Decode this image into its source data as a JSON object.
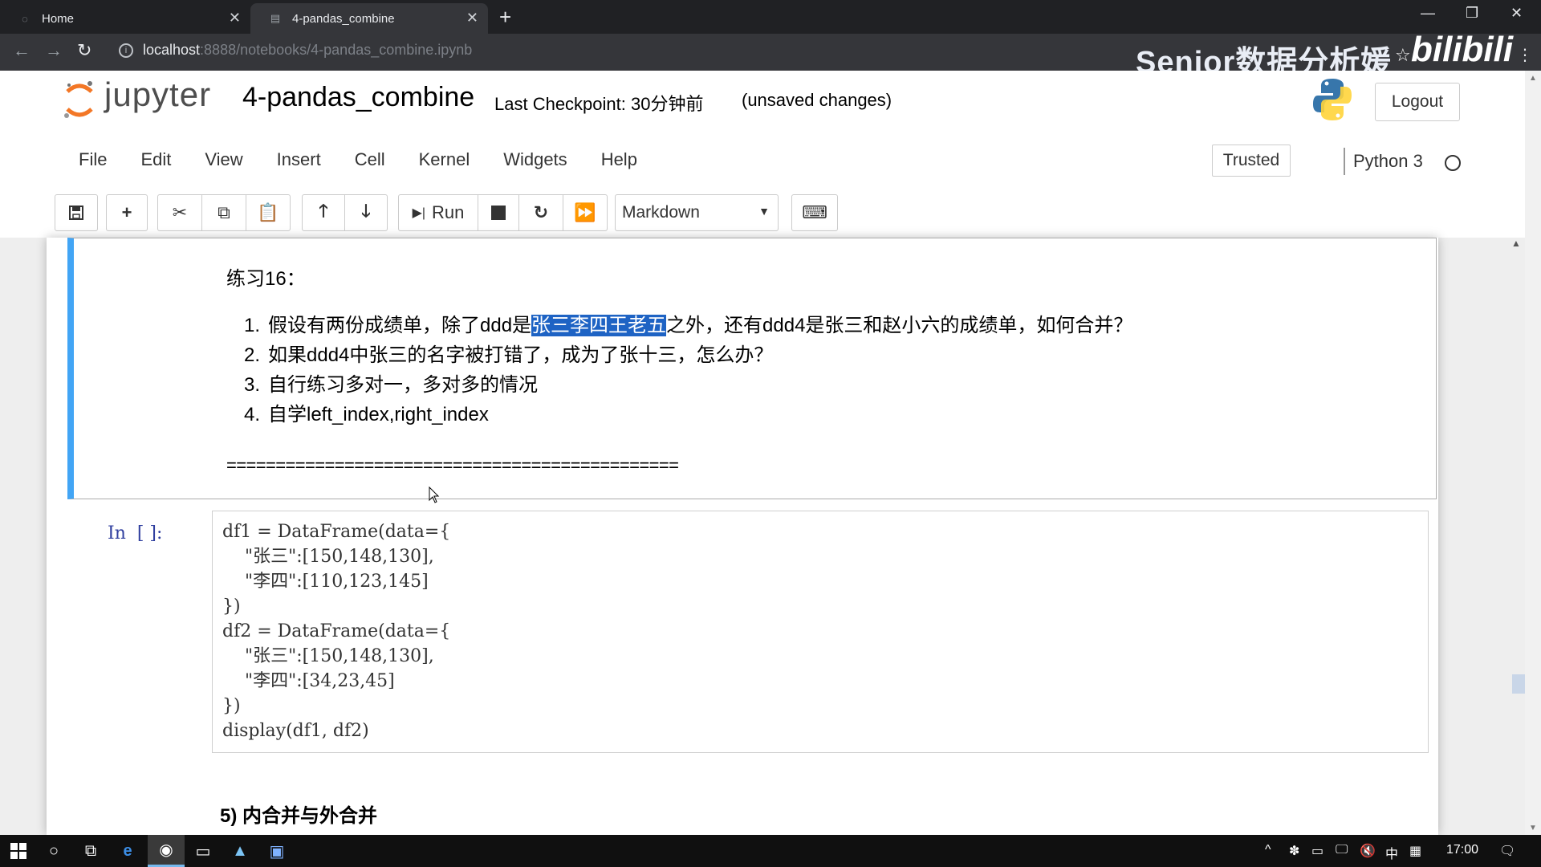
{
  "browser": {
    "tabs": [
      {
        "title": "Home",
        "active": false
      },
      {
        "title": "4-pandas_combine",
        "active": true
      }
    ],
    "new_tab": "+",
    "url_host": "localhost",
    "url_path": ":8888/notebooks/4-pandas_combine.ipynb",
    "watermark": "Senior数据分析媛",
    "watermark_brand": "bilibili"
  },
  "jupyter": {
    "logo_text": "jupyter",
    "notebook_title": "4-pandas_combine",
    "checkpoint": "Last Checkpoint: 30分钟前",
    "unsaved": "(unsaved changes)",
    "logout": "Logout",
    "menu": [
      "File",
      "Edit",
      "View",
      "Insert",
      "Cell",
      "Kernel",
      "Widgets",
      "Help"
    ],
    "trusted": "Trusted",
    "kernel": "Python 3",
    "toolbar": {
      "run_label": "Run",
      "cell_type": "Markdown"
    }
  },
  "cells": {
    "markdown": {
      "heading": "练习16：",
      "items": [
        {
          "num": "1.",
          "before": "假设有两份成绩单，除了ddd是",
          "highlight": "张三李四王老五",
          "after": "之外，还有ddd4是张三和赵小六的成绩单，如何合并？"
        },
        {
          "num": "2.",
          "text": "如果ddd4中张三的名字被打错了，成为了张十三，怎么办？"
        },
        {
          "num": "3.",
          "text": "自行练习多对一，多对多的情况"
        },
        {
          "num": "4.",
          "text": "自学left_index,right_index"
        }
      ],
      "rule": "=============================================="
    },
    "code": {
      "prompt": "In  [ ]:",
      "lines": [
        "df1 = DataFrame(data={",
        "    \"张三\":[150,148,130],",
        "    \"李四\":[110,123,145]",
        "})",
        "df2 = DataFrame(data={",
        "    \"张三\":[150,148,130],",
        "    \"李四\":[34,23,45]",
        "})",
        "display(df1, df2)"
      ]
    },
    "next_heading": "5) 内合并与外合并"
  },
  "taskbar": {
    "ime": "中",
    "time": "17:00"
  }
}
